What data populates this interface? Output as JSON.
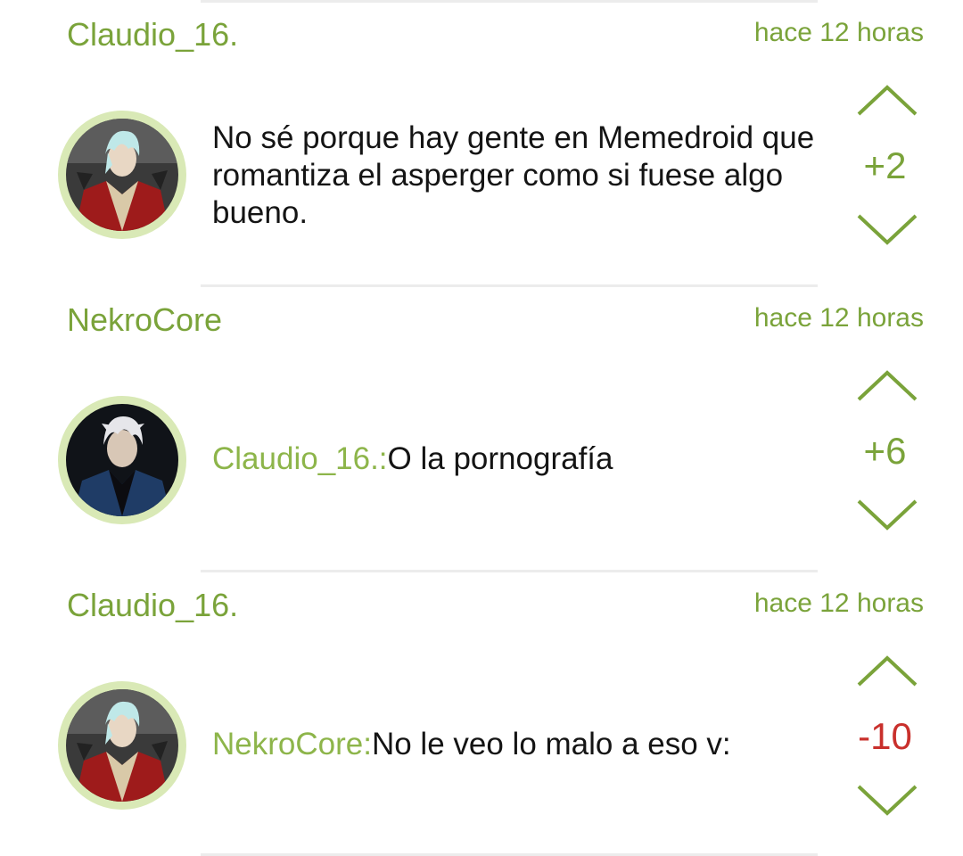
{
  "colors": {
    "accent": "#7aa33a",
    "mention": "#8db54a",
    "negative": "#c9302c",
    "avatar_ring": "#d9e9b6",
    "divider": "#ececec"
  },
  "comments": [
    {
      "username": "Claudio_16.",
      "timestamp": "hace 12 horas",
      "mention": "",
      "text": "No sé porque hay gente en Memedroid que romantiza el asperger como si fuese algo bueno.",
      "score": "+2",
      "avatar_icon": "red-coat-character-avatar",
      "upvote_icon": "chevron-up-icon",
      "downvote_icon": "chevron-down-icon"
    },
    {
      "username": "NekroCore",
      "timestamp": "hace 12 horas",
      "mention": "Claudio_16.:",
      "text": "O la pornografía",
      "score": "+6",
      "avatar_icon": "blue-coat-character-avatar",
      "upvote_icon": "chevron-up-icon",
      "downvote_icon": "chevron-down-icon"
    },
    {
      "username": "Claudio_16.",
      "timestamp": "hace 12 horas",
      "mention": "NekroCore:",
      "text": "No le veo lo malo a eso v:",
      "score": "-10",
      "avatar_icon": "red-coat-character-avatar",
      "upvote_icon": "chevron-up-icon",
      "downvote_icon": "chevron-down-icon"
    }
  ]
}
